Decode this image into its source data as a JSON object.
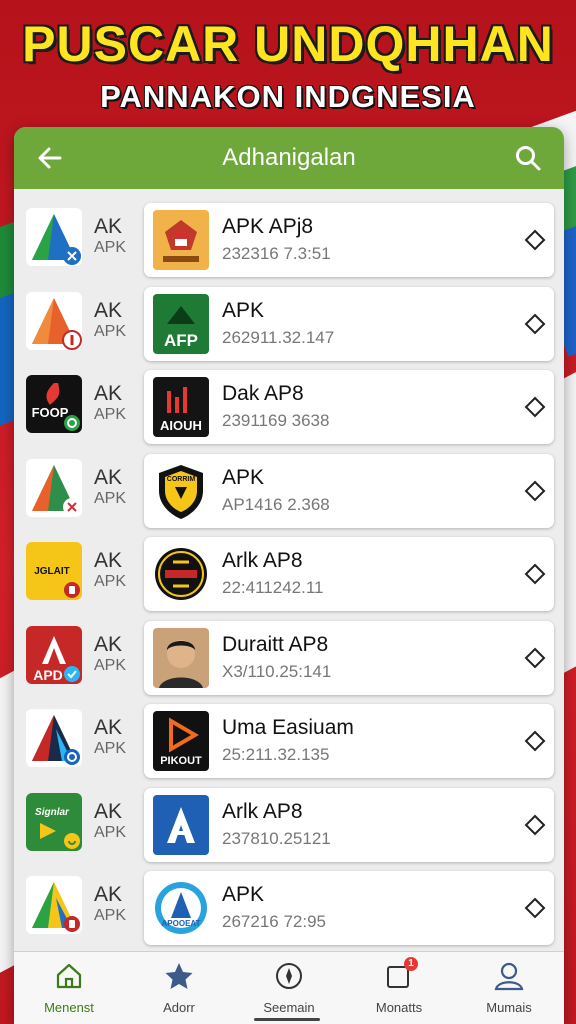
{
  "headline": {
    "title": "PUSCAR UNDQHHAN",
    "subtitle": "PANNAKON INDGNESIA"
  },
  "appbar": {
    "title": "Adhanigalan",
    "back_icon": "arrow-left-icon",
    "search_icon": "search-icon"
  },
  "rows": [
    {
      "left_a": "AK",
      "left_b": "APK",
      "name": "APK APj8",
      "version": "232316 7.3:51"
    },
    {
      "left_a": "AK",
      "left_b": "APK",
      "name": "APK",
      "version": "262911.32.147",
      "thumb_text": "AFP"
    },
    {
      "left_a": "AK",
      "left_b": "APK",
      "name": "Dak AP8",
      "version": "2391169 3638",
      "thumb_text": "AIOUH",
      "left_logo_text": "FOOP"
    },
    {
      "left_a": "AK",
      "left_b": "APK",
      "name": "APK",
      "version": "AP1416 2.368",
      "thumb_text": "CORRIM"
    },
    {
      "left_a": "AK",
      "left_b": "APK",
      "name": "Arlk AP8",
      "version": "22:411242.11",
      "left_logo_text": "JGLAIT"
    },
    {
      "left_a": "AK",
      "left_b": "APK",
      "name": "Duraitt AP8",
      "version": "X3/110.25:141",
      "left_logo_text": "APD"
    },
    {
      "left_a": "AK",
      "left_b": "APK",
      "name": "Uma Easiuam",
      "version": "25:211.32.135",
      "thumb_text": "PIKOUT"
    },
    {
      "left_a": "AK",
      "left_b": "APK",
      "name": "Arlk AP8",
      "version": "237810.25121",
      "left_logo_text": "Signlar"
    },
    {
      "left_a": "AK",
      "left_b": "APK",
      "name": "APK",
      "version": "267216 72:95",
      "thumb_text": "APOOEAT"
    }
  ],
  "tabs": [
    {
      "label": "Menenst",
      "icon": "home-icon"
    },
    {
      "label": "Adorr",
      "icon": "star-icon"
    },
    {
      "label": "Seemain",
      "icon": "compass-icon"
    },
    {
      "label": "Monatts",
      "icon": "notification-icon",
      "badge": "1"
    },
    {
      "label": "Mumais",
      "icon": "profile-icon"
    }
  ],
  "colors": {
    "appbar": "#6ea73a",
    "headline": "#ffe51f",
    "background": "#c8161d"
  }
}
